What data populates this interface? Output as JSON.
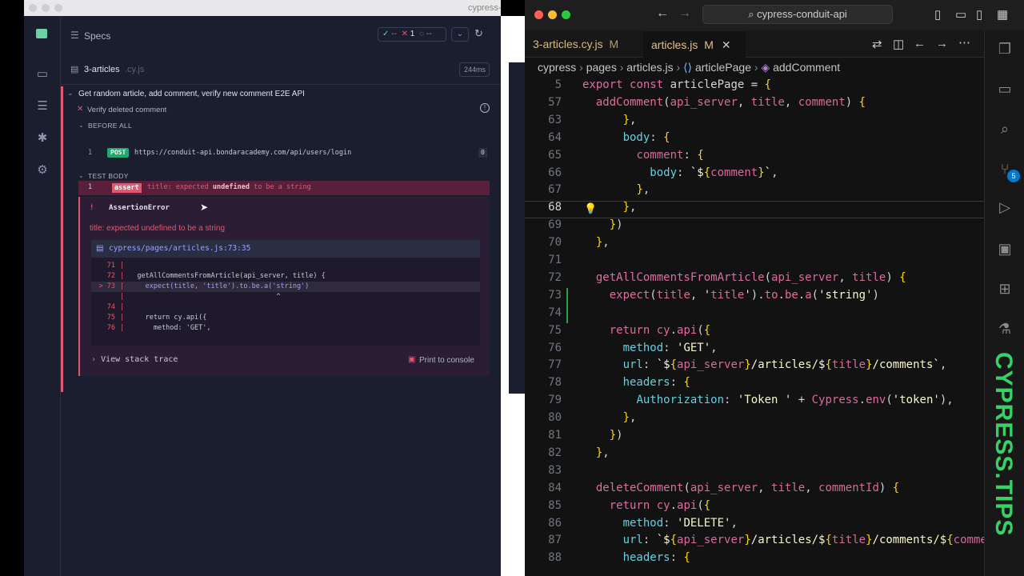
{
  "cypress": {
    "window_title_fragment": "cypress-c",
    "specs_label": "Specs",
    "status": {
      "passed": "--",
      "failed": "1",
      "pending": "--"
    },
    "spec_file": {
      "name": "3-articles",
      "ext": ".cy.js",
      "duration": "244ms"
    },
    "suite_title": "Get random article, add comment, verify new comment E2E API",
    "test_title": "Verify deleted comment",
    "before_all_label": "BEFORE ALL",
    "before_cmd": {
      "index": "1",
      "method": "POST",
      "url": "https://conduit-api.bondaracademy.com/api/users/login",
      "count": "0"
    },
    "test_body_label": "TEST BODY",
    "assert_cmd": {
      "index": "1",
      "badge": "assert",
      "text_pre": "title: expected",
      "text_bold": "undefined",
      "text_post": "to be a string"
    },
    "error": {
      "marker": "!",
      "name": "AssertionError",
      "message": "title: expected undefined to be a string",
      "file_link": "cypress/pages/articles.js:73:35",
      "code_lines": [
        {
          "num": "71",
          "code": ""
        },
        {
          "num": "72",
          "code": "  getAllCommentsFromArticle(api_server, title) {"
        },
        {
          "num": "> 73",
          "code": "    expect(title, 'title').to.be.a('string')"
        },
        {
          "num": "",
          "code": "                                    ^"
        },
        {
          "num": "74",
          "code": ""
        },
        {
          "num": "75",
          "code": "    return cy.api({"
        },
        {
          "num": "76",
          "code": "      method: 'GET',"
        }
      ],
      "stack_trace_label": "View stack trace",
      "print_label": "Print to console"
    }
  },
  "vscode": {
    "search_text": "cypress-conduit-api",
    "tabs": [
      {
        "label": "3-articles.cy.js",
        "mod": "M",
        "active": false
      },
      {
        "label": "articles.js",
        "mod": "M",
        "active": true
      }
    ],
    "breadcrumbs": [
      "cypress",
      "pages",
      "articles.js",
      "articlePage",
      "addComment"
    ],
    "source_control_badge": "5",
    "lines": [
      {
        "n": "5",
        "t": "export const articlePage = {"
      },
      {
        "n": "57",
        "t": "  addComment(api_server, title, comment) {"
      },
      {
        "n": "63",
        "t": "      },"
      },
      {
        "n": "64",
        "t": "      body: {"
      },
      {
        "n": "65",
        "t": "        comment: {"
      },
      {
        "n": "66",
        "t": "          body: `${comment}`,"
      },
      {
        "n": "67",
        "t": "        },"
      },
      {
        "n": "68",
        "t": "      },"
      },
      {
        "n": "69",
        "t": "    })"
      },
      {
        "n": "70",
        "t": "  },"
      },
      {
        "n": "71",
        "t": ""
      },
      {
        "n": "72",
        "t": "  getAllCommentsFromArticle(api_server, title) {"
      },
      {
        "n": "73",
        "t": "    expect(title, 'title').to.be.a('string')"
      },
      {
        "n": "74",
        "t": ""
      },
      {
        "n": "75",
        "t": "    return cy.api({"
      },
      {
        "n": "76",
        "t": "      method: 'GET',"
      },
      {
        "n": "77",
        "t": "      url: `${api_server}/articles/${title}/comments`,"
      },
      {
        "n": "78",
        "t": "      headers: {"
      },
      {
        "n": "79",
        "t": "        Authorization: 'Token ' + Cypress.env('token'),"
      },
      {
        "n": "80",
        "t": "      },"
      },
      {
        "n": "81",
        "t": "    })"
      },
      {
        "n": "82",
        "t": "  },"
      },
      {
        "n": "83",
        "t": ""
      },
      {
        "n": "84",
        "t": "  deleteComment(api_server, title, commentId) {"
      },
      {
        "n": "85",
        "t": "    return cy.api({"
      },
      {
        "n": "86",
        "t": "      method: 'DELETE',"
      },
      {
        "n": "87",
        "t": "      url: `${api_server}/articles/${title}/comments/${commentId}`,"
      },
      {
        "n": "88",
        "t": "      headers: {"
      }
    ],
    "active_line": "68",
    "watermark": "CYPRESS.TIPS"
  }
}
